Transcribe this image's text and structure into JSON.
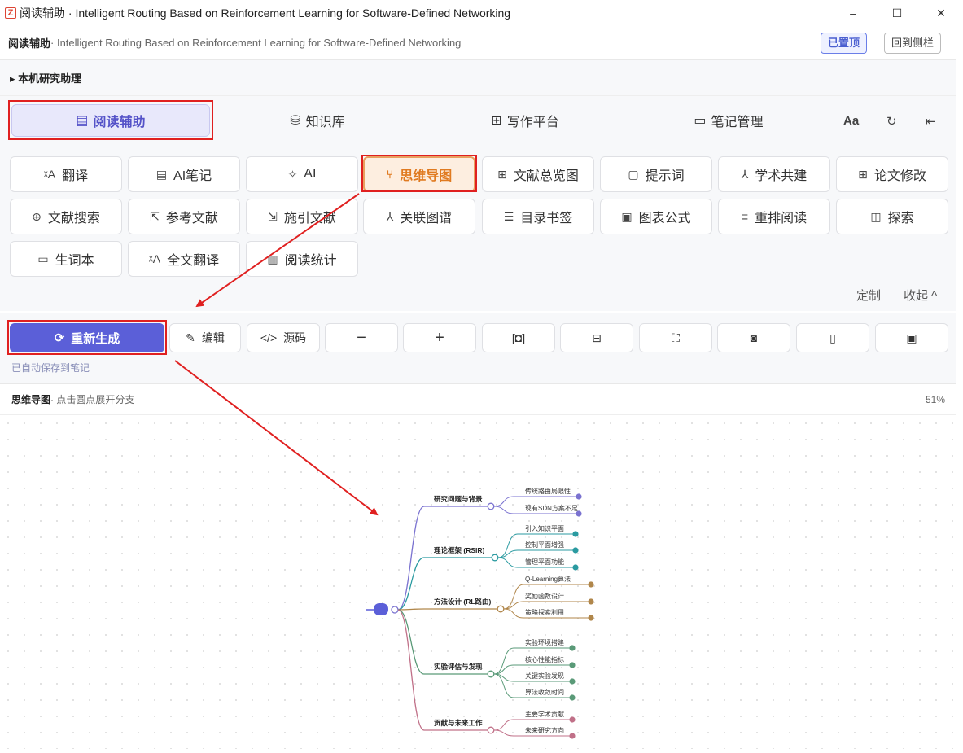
{
  "window": {
    "app_icon": "Z",
    "title": "阅读辅助 · Intelligent Routing Based on Reinforcement Learning for Software-Defined Networking",
    "controls": [
      "–",
      "☐",
      "✕"
    ]
  },
  "header": {
    "title": "阅读辅助",
    "subtitle": " · Intelligent Routing Based on Reinforcement Learning for Software-Defined Networking",
    "pinned_label": "已置顶",
    "back_label": "回到侧栏"
  },
  "assistant": {
    "label": "▸ 本机研究助理"
  },
  "tabs": [
    {
      "label": "阅读辅助",
      "icon": "document-icon"
    },
    {
      "label": "知识库",
      "icon": "database-icon"
    },
    {
      "label": "写作平台",
      "icon": "grid-icon"
    },
    {
      "label": "笔记管理",
      "icon": "folder-icon"
    }
  ],
  "tab_extras": {
    "font_label": "Aa",
    "refresh": "↻",
    "collapse": "⇤"
  },
  "tools": [
    {
      "label": "翻译",
      "icon": "translate-icon"
    },
    {
      "label": "AI笔记",
      "icon": "note-icon"
    },
    {
      "label": "AI",
      "icon": "sparkle-icon"
    },
    {
      "label": "思维导图",
      "icon": "mindmap-icon"
    },
    {
      "label": "文献总览图",
      "icon": "grid-icon"
    },
    {
      "label": "提示词",
      "icon": "chat-icon"
    },
    {
      "label": "学术共建",
      "icon": "network-icon"
    },
    {
      "label": "论文修改",
      "icon": "grid-icon"
    },
    {
      "label": "文献搜索",
      "icon": "zoom-icon"
    },
    {
      "label": "参考文献",
      "icon": "link-icon"
    },
    {
      "label": "施引文献",
      "icon": "cite-icon"
    },
    {
      "label": "关联图谱",
      "icon": "network-icon"
    },
    {
      "label": "目录书签",
      "icon": "list-icon"
    },
    {
      "label": "图表公式",
      "icon": "image-icon"
    },
    {
      "label": "重排阅读",
      "icon": "reflow-icon"
    },
    {
      "label": "探索",
      "icon": "book-icon"
    },
    {
      "label": "生词本",
      "icon": "notebook-icon"
    },
    {
      "label": "全文翻译",
      "icon": "translate-icon"
    },
    {
      "label": "阅读统计",
      "icon": "stats-icon"
    }
  ],
  "tools_footer": {
    "customize": "定制",
    "collapse": "收起 ^"
  },
  "actions": {
    "regenerate": "重新生成",
    "edit": "编辑",
    "source": "源码",
    "icons": [
      "−",
      "+",
      "fit-icon",
      "tree-icon",
      "fullscreen-icon",
      "camera-icon",
      "file-icon",
      "save-icon"
    ]
  },
  "saved_note": "已自动保存到笔记",
  "mindmap": {
    "title": "思维导图",
    "subtitle": " · 点击圆点展开分支",
    "zoom": "51%",
    "branches": [
      {
        "label": "研究问题与背景",
        "color": "#7a72d0",
        "children": [
          "传统路由局限性",
          "现有SDN方案不足"
        ]
      },
      {
        "label": "理论框架 (RSIR)",
        "color": "#2a9aa0",
        "children": [
          "引入知识平面",
          "控制平面增强",
          "管理平面功能"
        ]
      },
      {
        "label": "方法设计 (RL路由)",
        "color": "#b0864a",
        "children": [
          "Q-Learning算法",
          "奖励函数设计",
          "策略探索利用"
        ]
      },
      {
        "label": "实验评估与发现",
        "color": "#5a9a78",
        "children": [
          "实验环境搭建",
          "核心性能指标",
          "关键实验发现",
          "算法收敛时间"
        ]
      },
      {
        "label": "贡献与未来工作",
        "color": "#c07088",
        "children": [
          "主要学术贡献",
          "未来研究方向"
        ]
      }
    ]
  },
  "colors": {
    "accent": "#5b5fd8",
    "highlight": "#e07a20",
    "annotation": "#e02020"
  }
}
